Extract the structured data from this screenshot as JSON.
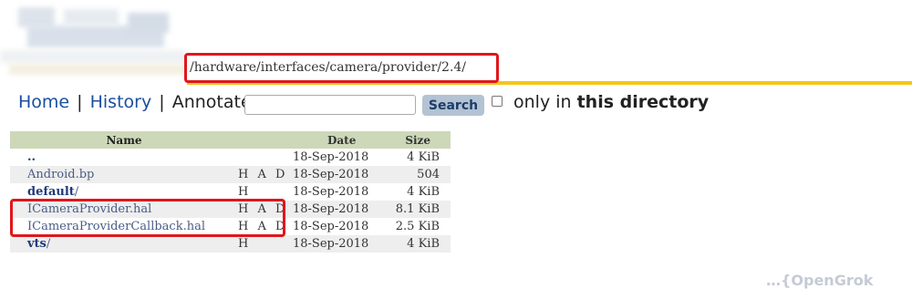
{
  "path": "/hardware/interfaces/camera/provider/2.4/",
  "nav": {
    "home": "Home",
    "sep1": "|",
    "history": "History",
    "sep2": "|",
    "annotate": "Annotate"
  },
  "search": {
    "button": "Search",
    "value": "",
    "placeholder": ""
  },
  "only_in": {
    "prefix": "only in ",
    "bold": "this directory"
  },
  "table": {
    "headers": {
      "name": "Name",
      "date": "Date",
      "size": "Size"
    },
    "rows": [
      {
        "name": "..",
        "hist": "",
        "date": "18-Sep-2018",
        "size": "4 KiB",
        "type": "dir"
      },
      {
        "name": "Android.bp",
        "hist": "H A D",
        "date": "18-Sep-2018",
        "size": "504",
        "type": "file"
      },
      {
        "name": "default",
        "trail": "/",
        "hist": "H",
        "date": "18-Sep-2018",
        "size": "4 KiB",
        "type": "dir"
      },
      {
        "name": "ICameraProvider.hal",
        "hist": "H A D",
        "date": "18-Sep-2018",
        "size": "8.1 KiB",
        "type": "file"
      },
      {
        "name": "ICameraProviderCallback.hal",
        "hist": "H A D",
        "date": "18-Sep-2018",
        "size": "2.5 KiB",
        "type": "file"
      },
      {
        "name": "vts",
        "trail": "/",
        "hist": "H",
        "date": "18-Sep-2018",
        "size": "4 KiB",
        "type": "dir"
      }
    ]
  },
  "colors": {
    "highlight_box": "#e0161b",
    "path_underline": "#f5c518",
    "header_bg": "#ccd8b8",
    "alt_row_bg": "#eeeeee",
    "link": "#1b4fa0"
  },
  "watermark": "…{OpenGrok"
}
